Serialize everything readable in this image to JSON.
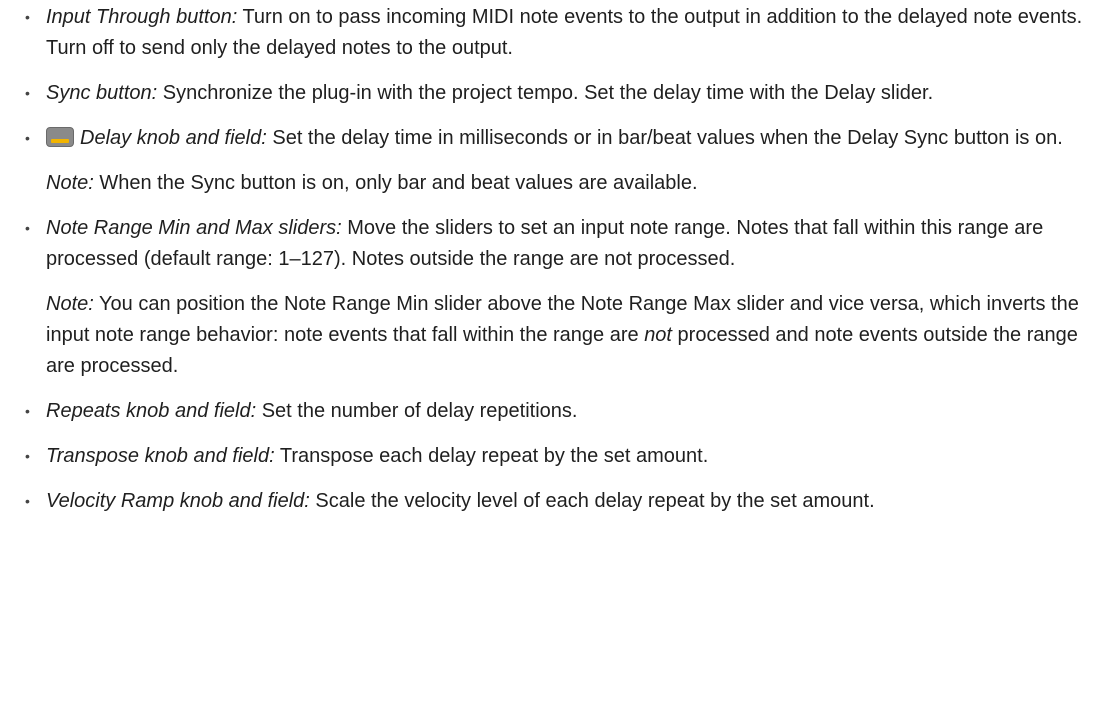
{
  "items": [
    {
      "term": "Input Through button:",
      "text": " Turn on to pass incoming MIDI note events to the output in addition to the delayed note events. Turn off to send only the delayed notes to the output."
    },
    {
      "term": "Sync button:",
      "text": " Synchronize the plug-in with the project tempo. Set the delay time with the Delay slider."
    },
    {
      "icon": "delay-display-icon",
      "term": "Delay knob and field:",
      "text": " Set the delay time in milliseconds or in bar/beat values when the Delay Sync button is on.",
      "note_label": "Note:",
      "note_text": " When the Sync button is on, only bar and beat values are available."
    },
    {
      "term": "Note Range Min and Max sliders:",
      "text": " Move the sliders to set an input note range. Notes that fall within this range are processed (default range: 1–127). Notes outside the range are not processed.",
      "note_label": "Note:",
      "note_text_1": " You can position the Note Range Min slider above the Note Range Max slider and vice versa, which inverts the input note range behavior: note events that fall within the range are ",
      "note_em": "not",
      "note_text_2": " processed and note events outside the range are processed."
    },
    {
      "term": "Repeats knob and field:",
      "text": " Set the number of delay repetitions."
    },
    {
      "term": "Transpose knob and field:",
      "text": " Transpose each delay repeat by the set amount."
    },
    {
      "term": "Velocity Ramp knob and field:",
      "text": " Scale the velocity level of each delay repeat by the set amount."
    }
  ],
  "bullet_char": "•",
  "colors": {
    "text": "#1f1f1f",
    "icon_body": "#8a8a8a",
    "icon_accent": "#f2b400"
  }
}
